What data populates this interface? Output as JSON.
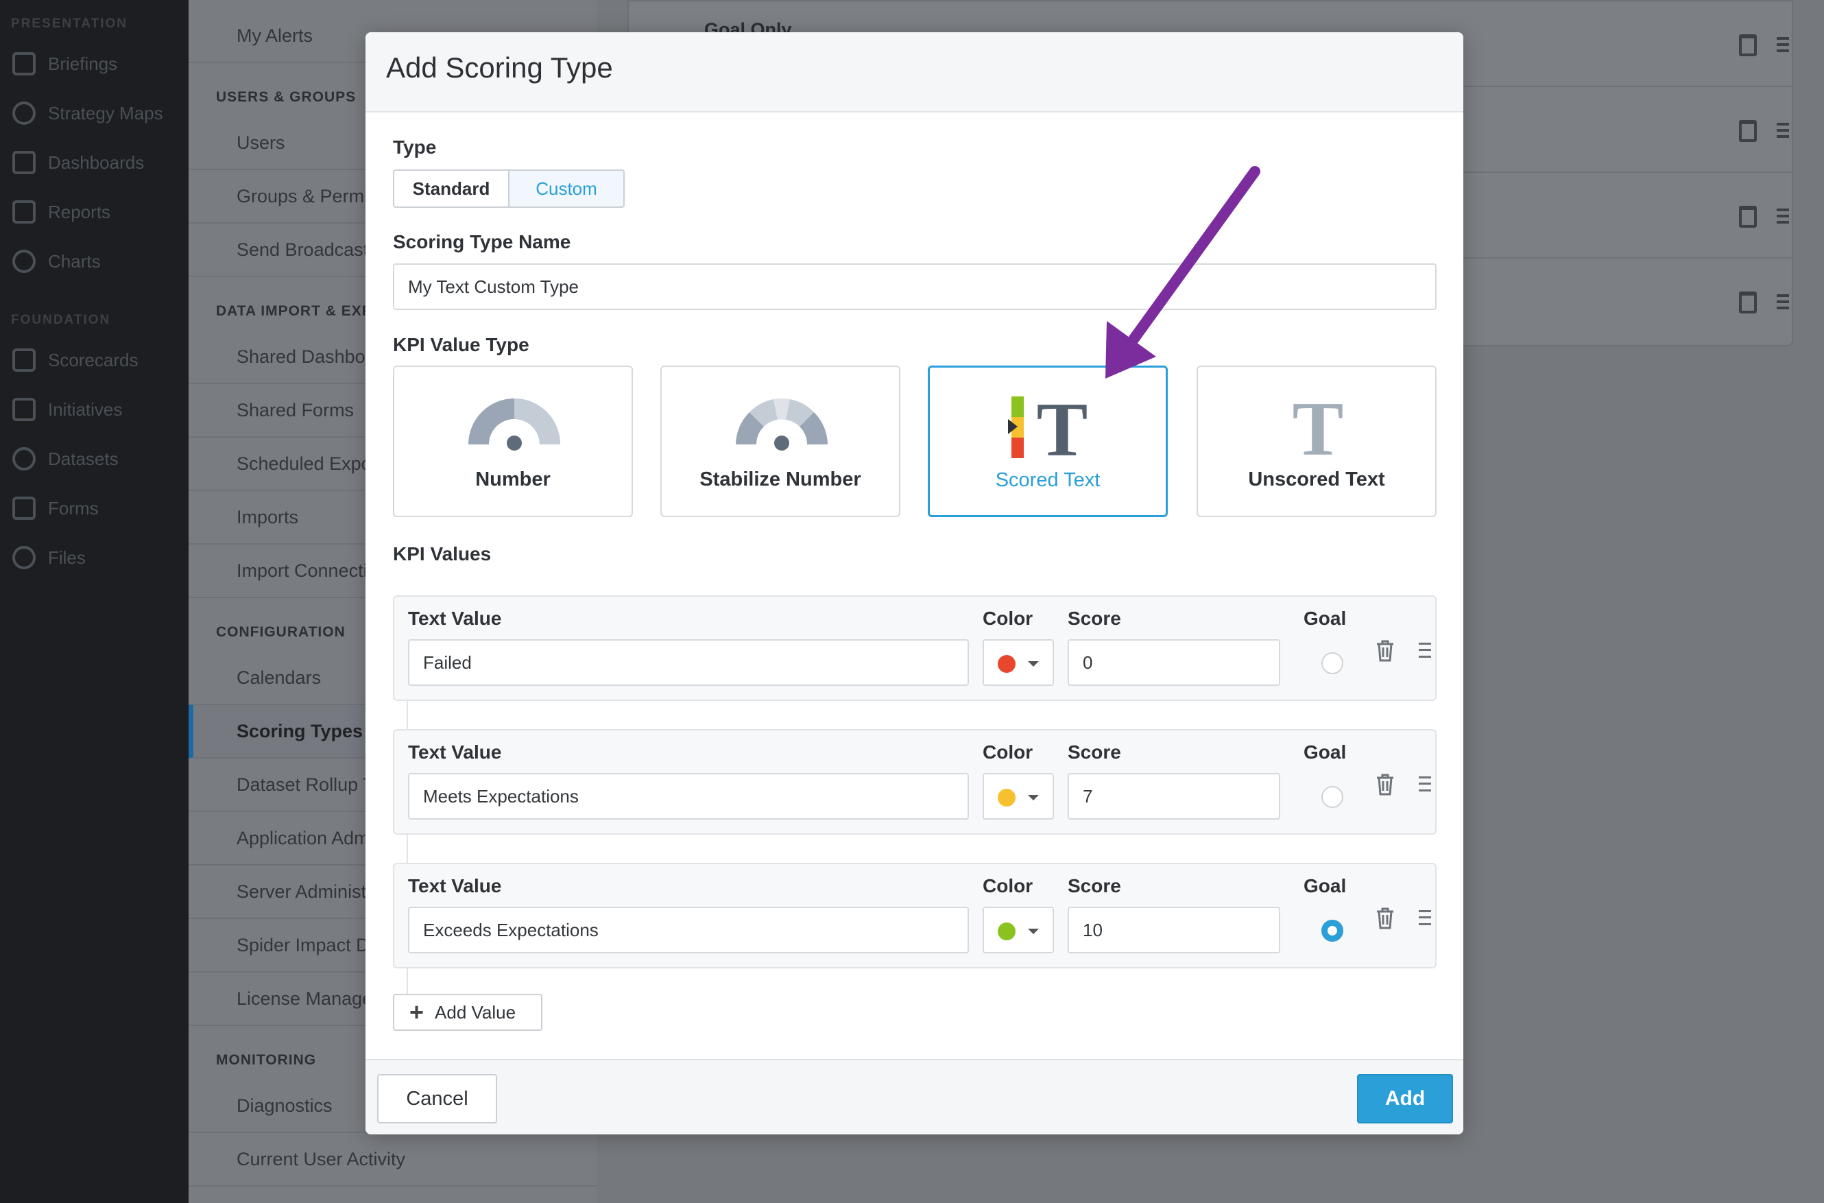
{
  "nav": {
    "presentation_heading": "PRESENTATION",
    "foundation_heading": "FOUNDATION",
    "presentation_items": [
      "Briefings",
      "Strategy Maps",
      "Dashboards",
      "Reports",
      "Charts"
    ],
    "foundation_items": [
      "Scorecards",
      "Initiatives",
      "Datasets",
      "Forms",
      "Files"
    ]
  },
  "admin_menu": {
    "my_alerts": "My Alerts",
    "users_groups_heading": "USERS & GROUPS",
    "users": "Users",
    "groups_permissions": "Groups & Permi",
    "send_broadcast": "Send Broadcast",
    "data_import_heading": "DATA IMPORT & EXPO",
    "shared_dashboards": "Shared Dashbo",
    "shared_forms": "Shared Forms",
    "scheduled_exports": "Scheduled Expo",
    "imports": "Imports",
    "import_connections": "Import Connecti",
    "configuration_heading": "CONFIGURATION",
    "calendars": "Calendars",
    "scoring_types": "Scoring Types",
    "dataset_rollup": "Dataset Rollup T",
    "application_admin": "Application Adm",
    "server_admin": "Server Administ",
    "spider_impact": "Spider Impact D",
    "license_manager": "License Manage",
    "monitoring_heading": "MONITORING",
    "diagnostics": "Diagnostics",
    "current_user_activity": "Current User Activity"
  },
  "background_list": {
    "first_row_label": "Goal Only"
  },
  "modal": {
    "title": "Add Scoring Type",
    "type_label": "Type",
    "type_options": [
      "Standard",
      "Custom"
    ],
    "type_selected": "Custom",
    "name_label": "Scoring Type Name",
    "name_value": "My Text Custom Type",
    "kpi_value_type_label": "KPI Value Type",
    "kpi_value_types": [
      {
        "label": "Number",
        "icon": "gauge-icon"
      },
      {
        "label": "Stabilize Number",
        "icon": "stabilize-gauge-icon"
      },
      {
        "label": "Scored Text",
        "icon": "scored-text-icon"
      },
      {
        "label": "Unscored Text",
        "icon": "text-icon"
      }
    ],
    "kpi_value_type_selected": "Scored Text",
    "kpi_values_label": "KPI Values",
    "column_labels": {
      "text_value": "Text Value",
      "color": "Color",
      "score": "Score",
      "goal": "Goal"
    },
    "kpi_values": [
      {
        "text": "Failed",
        "color": "#e8472e",
        "score": "0",
        "goal": false
      },
      {
        "text": "Meets Expectations",
        "color": "#f6c02f",
        "score": "7",
        "goal": false
      },
      {
        "text": "Exceeds Expectations",
        "color": "#8cc21f",
        "score": "10",
        "goal": true
      }
    ],
    "add_value_label": "Add Value",
    "cancel_label": "Cancel",
    "add_label": "Add"
  },
  "colors": {
    "accent": "#2a9fd8",
    "annotation_arrow": "#7b2d9e"
  }
}
